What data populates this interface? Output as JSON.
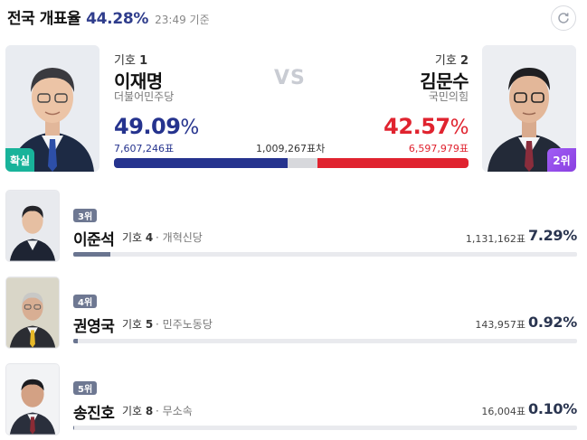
{
  "header": {
    "title": "전국 개표율",
    "count_pct": "44.28%",
    "time": "23:49 기준"
  },
  "top": {
    "vs": "VS",
    "c1": {
      "no_label": "기호",
      "no": "1",
      "name": "이재명",
      "party": "더불어민주당",
      "pct": "49.09",
      "pct_unit": "%",
      "votes": "7,607,246표",
      "badge": "확실",
      "share": 49.09
    },
    "c2": {
      "no_label": "기호",
      "no": "2",
      "name": "김문수",
      "party": "국민의힘",
      "pct": "42.57",
      "pct_unit": "%",
      "votes": "6,597,979표",
      "badge": "2위",
      "share": 42.57
    },
    "gap": "1,009,267표차",
    "colors": {
      "c1": "#25338e",
      "c2": "#e0232f"
    }
  },
  "others": [
    {
      "rank": "3위",
      "name": "이준석",
      "no_label": "기호",
      "no": "4",
      "sep": "·",
      "party": "개혁신당",
      "votes": "1,131,162표",
      "pct": "7.29%",
      "share": 7.29
    },
    {
      "rank": "4위",
      "name": "권영국",
      "no_label": "기호",
      "no": "5",
      "sep": "·",
      "party": "민주노동당",
      "votes": "143,957표",
      "pct": "0.92%",
      "share": 0.92
    },
    {
      "rank": "5위",
      "name": "송진호",
      "no_label": "기호",
      "no": "8",
      "sep": "·",
      "party": "무소속",
      "votes": "16,004표",
      "pct": "0.10%",
      "share": 0.1
    }
  ],
  "icons": {
    "refresh": "refresh-icon"
  }
}
